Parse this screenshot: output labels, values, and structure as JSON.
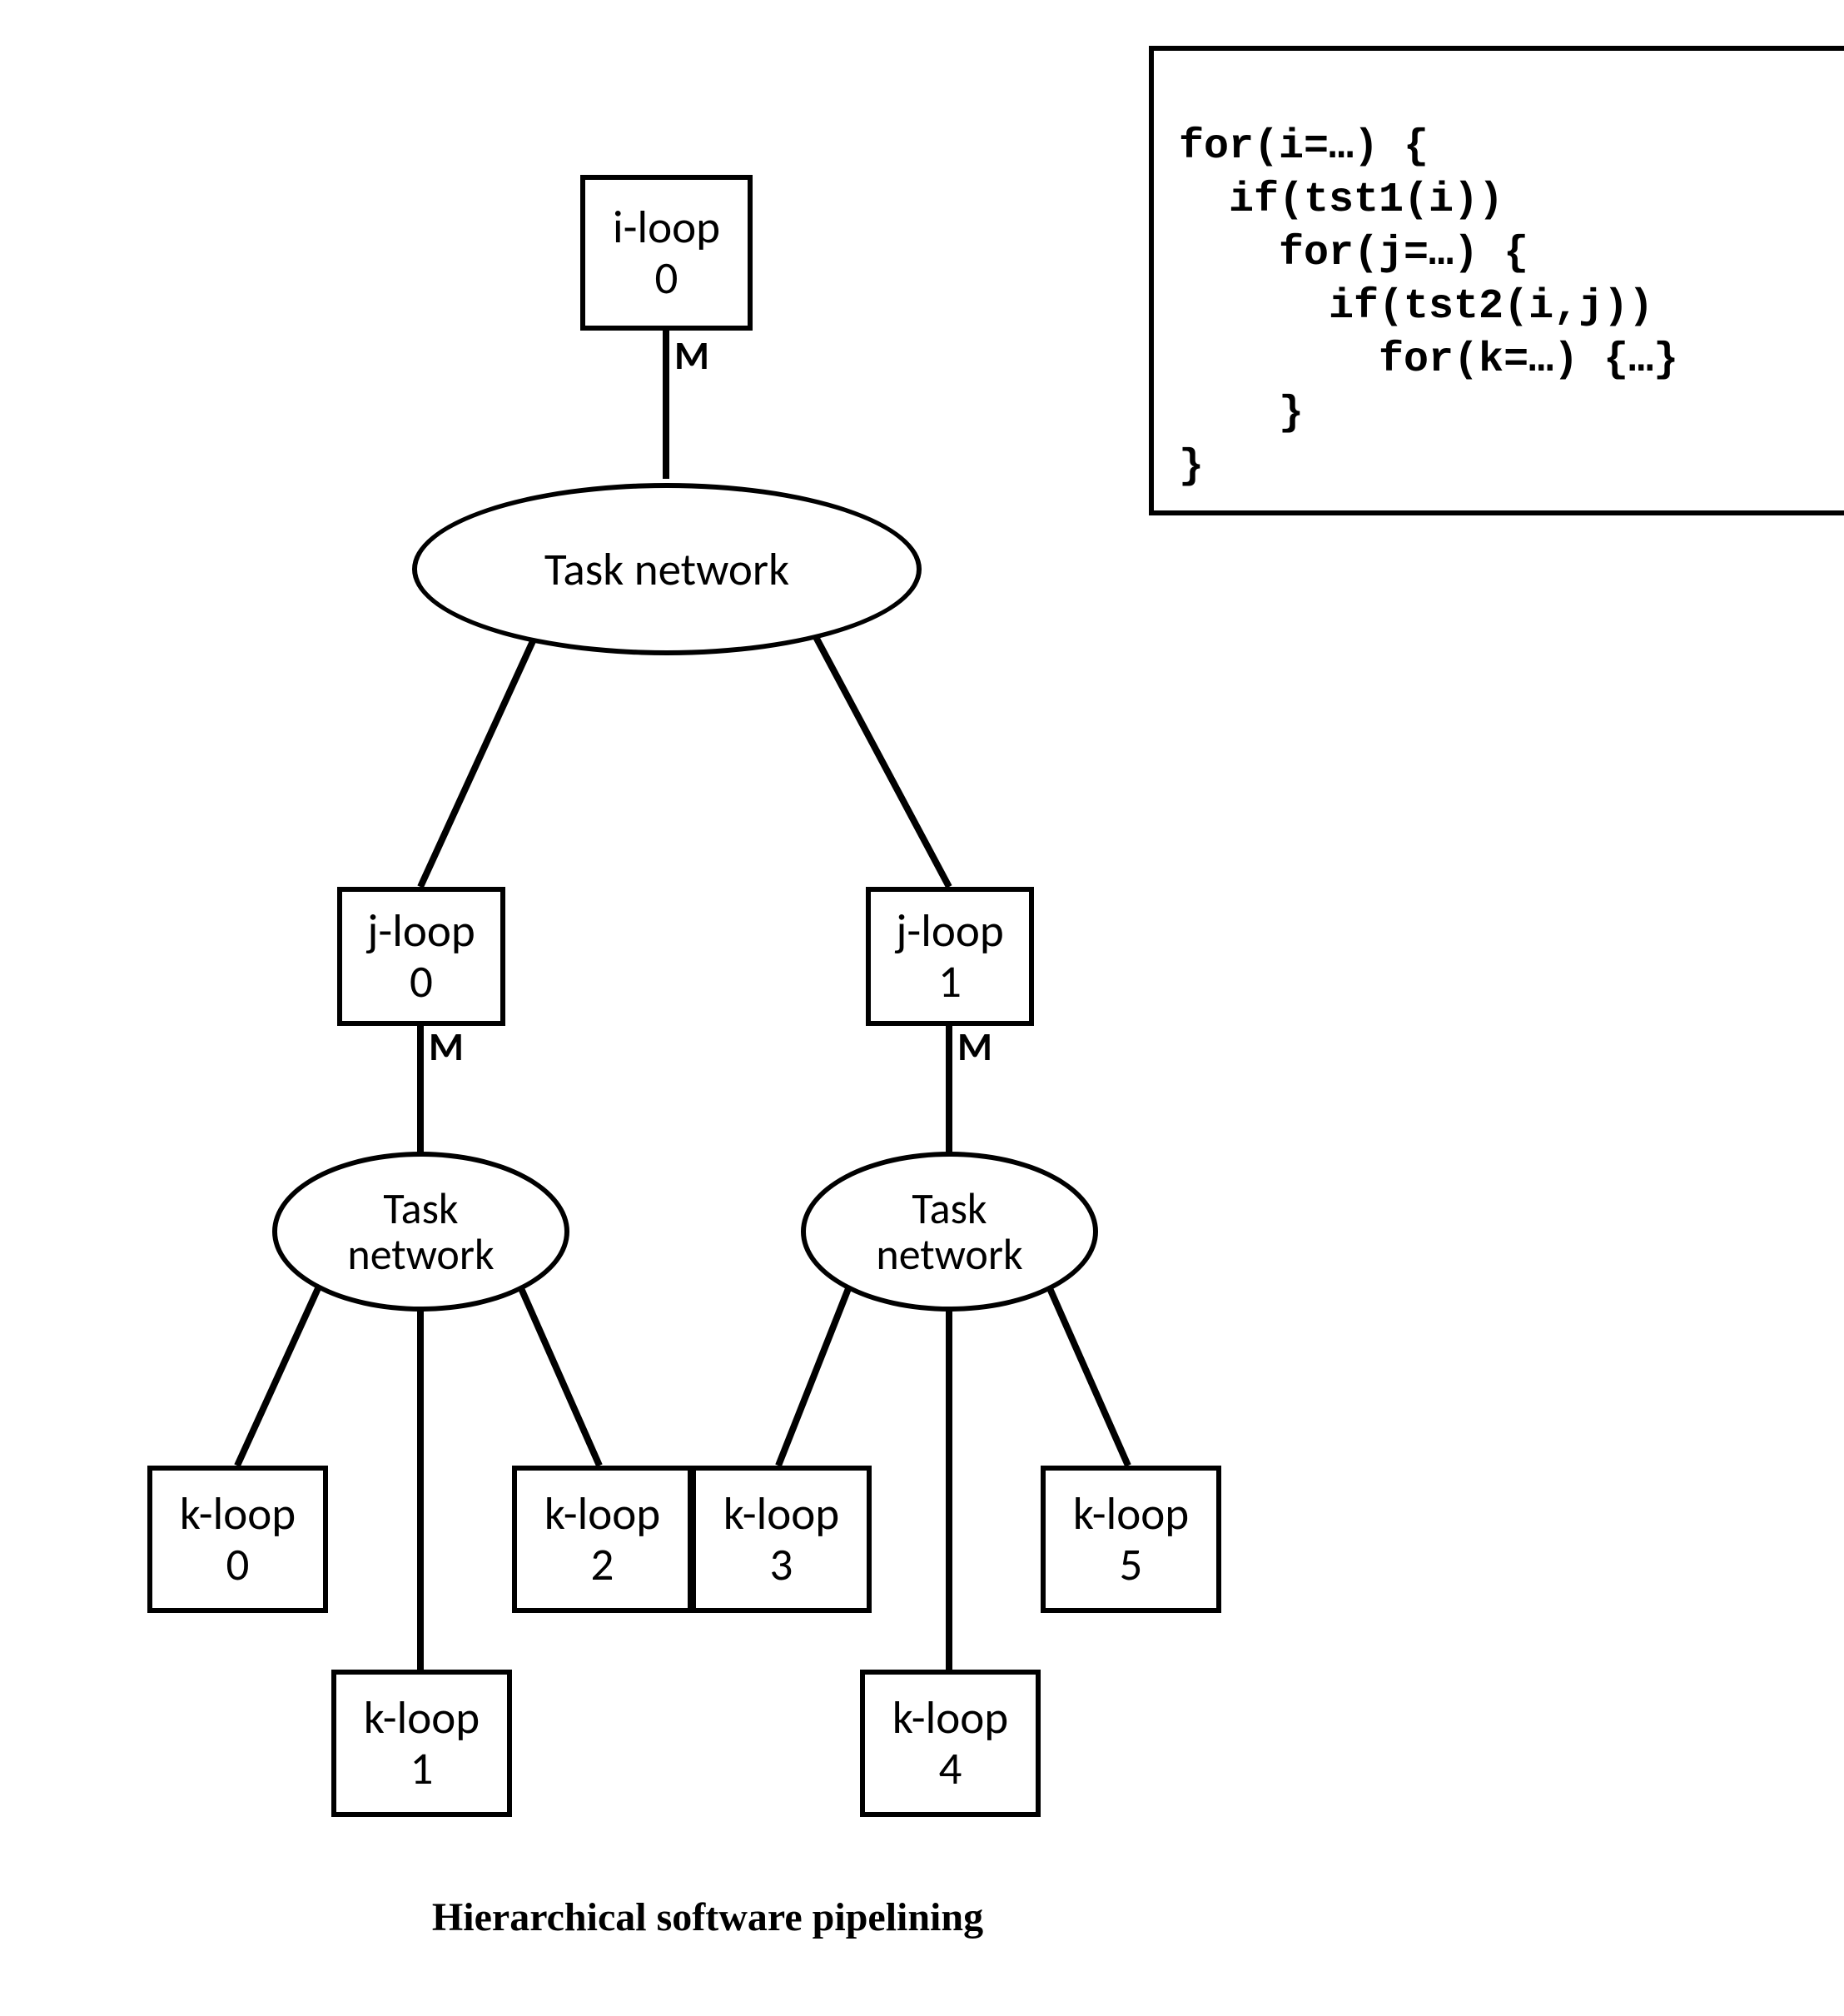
{
  "caption": "Hierarchical software pipelining",
  "code": {
    "l1": "for(i=…) {",
    "l2": "  if(tst1(i))",
    "l3": "    for(j=…) {",
    "l4": "      if(tst2(i,j))",
    "l5": "        for(k=…) {…}",
    "l6": "    }",
    "l7": "}"
  },
  "m_labels": {
    "top": "M",
    "j0": "M",
    "j1": "M"
  },
  "nodes": {
    "iloop": {
      "l1": "i-loop",
      "l2": "0"
    },
    "jloop0": {
      "l1": "j-loop",
      "l2": "0"
    },
    "jloop1": {
      "l1": "j-loop",
      "l2": "1"
    },
    "kloop0": {
      "l1": "k-loop",
      "l2": "0"
    },
    "kloop1": {
      "l1": "k-loop",
      "l2": "1"
    },
    "kloop2": {
      "l1": "k-loop",
      "l2": "2"
    },
    "kloop3": {
      "l1": "k-loop",
      "l2": "3"
    },
    "kloop4": {
      "l1": "k-loop",
      "l2": "4"
    },
    "kloop5": {
      "l1": "k-loop",
      "l2": "5"
    }
  },
  "ellipses": {
    "top": "Task network",
    "left": {
      "l1": "Task",
      "l2": "network"
    },
    "right": {
      "l1": "Task",
      "l2": "network"
    }
  }
}
